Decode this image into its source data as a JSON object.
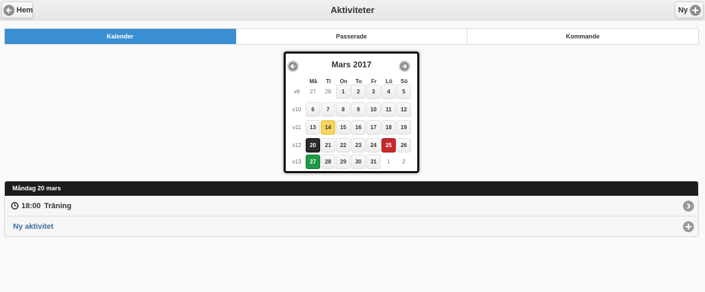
{
  "header": {
    "title": "Aktiviteter",
    "back_label": "Hem",
    "new_label": "Ny"
  },
  "tabs": [
    {
      "label": "Kalender",
      "active": true
    },
    {
      "label": "Passerade",
      "active": false
    },
    {
      "label": "Kommande",
      "active": false
    }
  ],
  "calendar": {
    "month_label": "Mars 2017",
    "weekdays": [
      "Må",
      "Ti",
      "On",
      "To",
      "Fr",
      "Lö",
      "Sö"
    ],
    "weeks": [
      {
        "label": "v9",
        "days": [
          {
            "d": "27",
            "other": true
          },
          {
            "d": "28",
            "other": true
          },
          {
            "d": "1"
          },
          {
            "d": "2"
          },
          {
            "d": "3"
          },
          {
            "d": "4"
          },
          {
            "d": "5"
          }
        ]
      },
      {
        "label": "v10",
        "days": [
          {
            "d": "6"
          },
          {
            "d": "7"
          },
          {
            "d": "8"
          },
          {
            "d": "9"
          },
          {
            "d": "10"
          },
          {
            "d": "11"
          },
          {
            "d": "12"
          }
        ]
      },
      {
        "label": "v11",
        "days": [
          {
            "d": "13"
          },
          {
            "d": "14",
            "style": "hl-yellow"
          },
          {
            "d": "15"
          },
          {
            "d": "16"
          },
          {
            "d": "17"
          },
          {
            "d": "18"
          },
          {
            "d": "19"
          }
        ]
      },
      {
        "label": "v12",
        "days": [
          {
            "d": "20",
            "style": "today"
          },
          {
            "d": "21"
          },
          {
            "d": "22"
          },
          {
            "d": "23"
          },
          {
            "d": "24"
          },
          {
            "d": "25",
            "style": "hl-red"
          },
          {
            "d": "26"
          }
        ]
      },
      {
        "label": "v13",
        "days": [
          {
            "d": "27",
            "style": "hl-green"
          },
          {
            "d": "28"
          },
          {
            "d": "29"
          },
          {
            "d": "30"
          },
          {
            "d": "31"
          },
          {
            "d": "1",
            "other": true
          },
          {
            "d": "2",
            "other": true
          }
        ]
      }
    ]
  },
  "day_list": {
    "heading": "Måndag 20 mars",
    "items": [
      {
        "time": "18:00",
        "title": "Träning"
      }
    ],
    "new_activity_label": "Ny aktivitet"
  },
  "colors": {
    "tab_active": "#3a8fd3",
    "today": "#2b2b2b",
    "highlight_yellow": "#f6d55e",
    "highlight_red": "#c42a2a",
    "highlight_green": "#1f9848",
    "link": "#3e6e9e"
  },
  "icons": {
    "back": "arrow-left-circle-icon",
    "new": "plus-circle-icon",
    "clock": "clock-icon",
    "row_arrow": "chevron-right-circle-icon",
    "add": "plus-circle-icon"
  }
}
